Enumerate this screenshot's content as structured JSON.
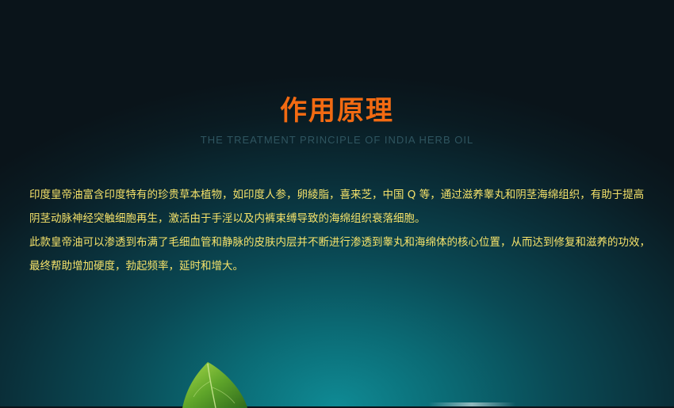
{
  "banner": {
    "title": "作用原理",
    "subtitle": "THE TREATMENT PRINCIPLE OF INDIA HERB OIL",
    "paragraphs": [
      "印度皇帝油富含印度特有的珍贵草本植物，如印度人参，卵綾脂，喜来芝，中国 Q 等，通过滋养睾丸和阴茎海绵组织，有助于提高阴茎动脉神经突触细胞再生，激活由于手淫以及内裤束缚导致的海绵组织衰落细胞。",
      "此款皇帝油可以渗透到布满了毛细血管和静脉的皮肤内层并不断进行渗透到睾丸和海绵体的核心位置，从而达到修复和滋养的功效，最终帮助增加硬度，勃起频率，延时和增大。"
    ]
  },
  "colors": {
    "title": "#f26a12",
    "subtitle": "#2f5560",
    "body_text": "#f5e26a",
    "background_glow": "#0f8a94",
    "background_dark": "#0a141a"
  }
}
